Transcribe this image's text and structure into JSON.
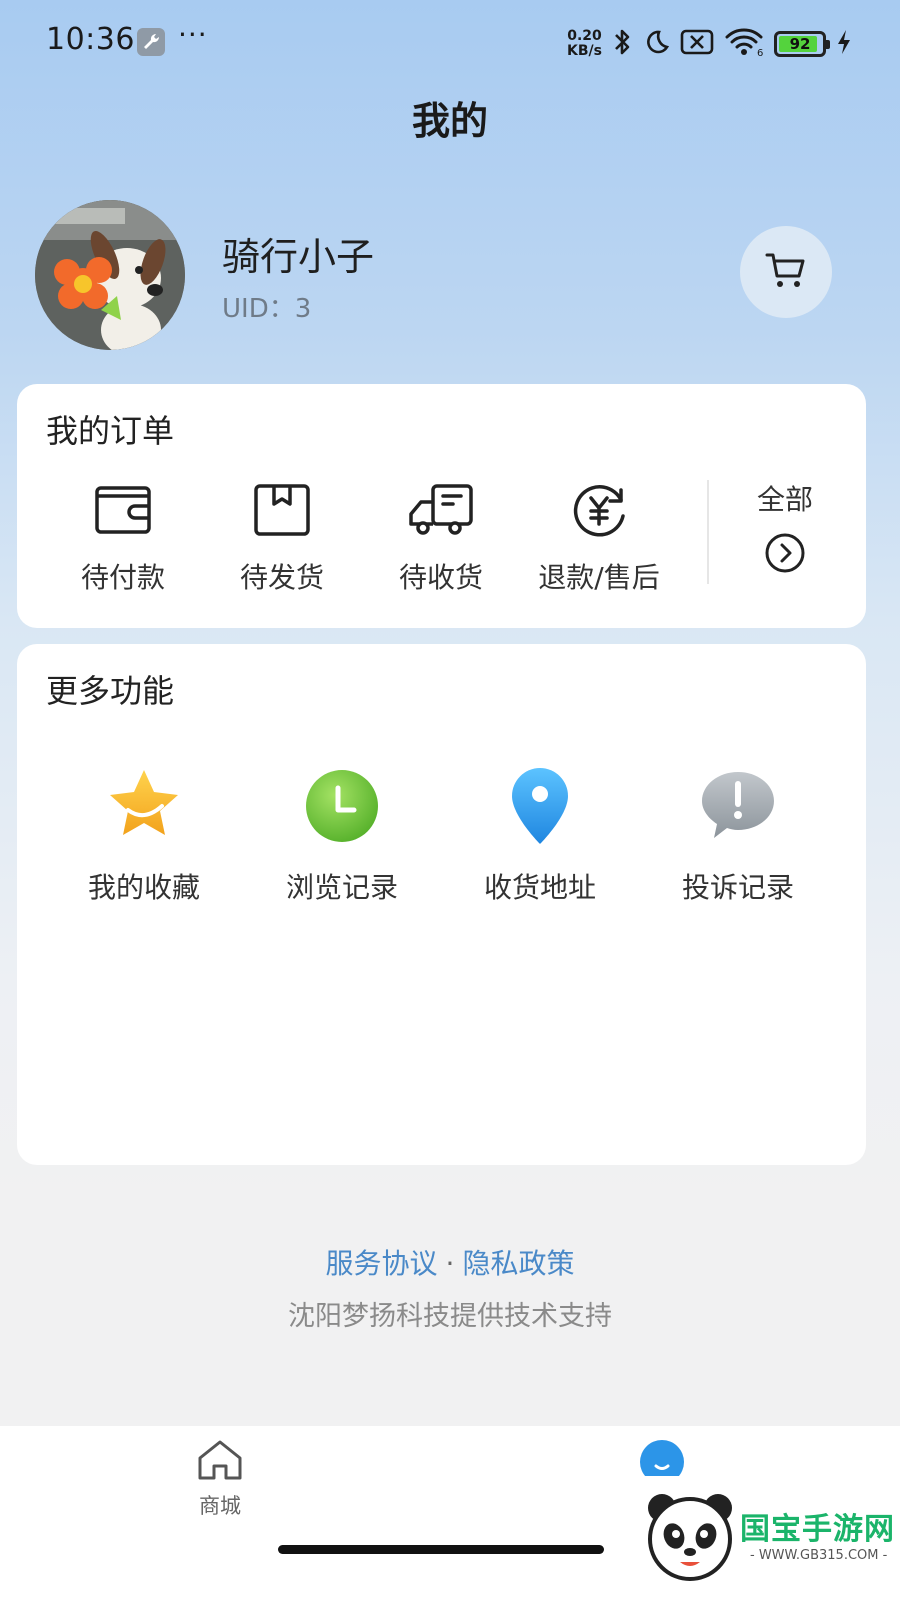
{
  "status_bar": {
    "time": "10:36",
    "more": "···",
    "net_speed_value": "0.20",
    "net_speed_unit": "KB/s",
    "battery": "92",
    "battery_level": 0.92,
    "wifi_badge": "6"
  },
  "page": {
    "title": "我的"
  },
  "profile": {
    "name": "骑行小子",
    "uid": "UID：3"
  },
  "orders": {
    "title": "我的订单",
    "items": [
      {
        "label": "待付款",
        "icon": "wallet-icon"
      },
      {
        "label": "待发货",
        "icon": "box-icon"
      },
      {
        "label": "待收货",
        "icon": "truck-icon"
      },
      {
        "label": "退款/售后",
        "icon": "refund-yen-icon"
      }
    ],
    "all_label": "全部"
  },
  "more": {
    "title": "更多功能",
    "items": [
      {
        "label": "我的收藏",
        "icon": "star-icon",
        "color": "#f5b82e"
      },
      {
        "label": "浏览记录",
        "icon": "clock-icon",
        "color": "#6cc23a"
      },
      {
        "label": "收货地址",
        "icon": "location-pin-icon",
        "color": "#2e9fe8"
      },
      {
        "label": "投诉记录",
        "icon": "exclamation-bubble-icon",
        "color": "#9aa1a8"
      }
    ]
  },
  "footer": {
    "service_agreement": "服务协议",
    "separator": "·",
    "privacy_policy": "隐私政策",
    "support": "沈阳梦扬科技提供技术支持"
  },
  "nav": {
    "home_label": "商城"
  },
  "watermark": {
    "text": "国宝手游网",
    "url": "- WWW.GB315.COM -"
  },
  "colors": {
    "link": "#4a89c8",
    "accent": "#2c95e8"
  }
}
